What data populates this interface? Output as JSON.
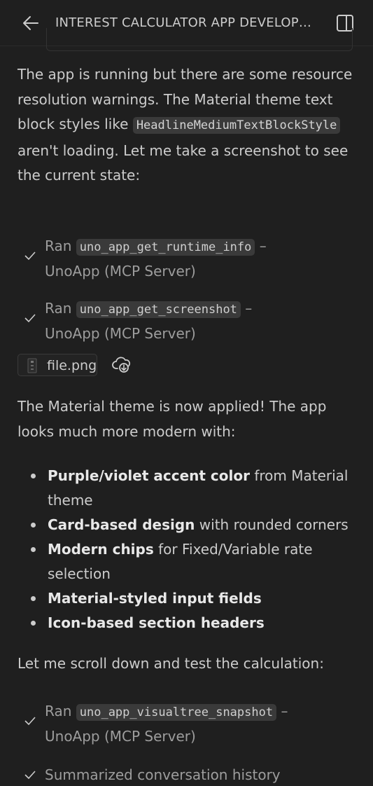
{
  "header": {
    "title": "INTEREST CALCULATOR APP DEVELOPMENT",
    "back_icon": "arrow-left-icon",
    "panel_icon": "sidebar-panel-icon"
  },
  "intro": {
    "text1": "The app is running but there are some resource resolution warnings. The Material theme text block styles like",
    "code": "HeadlineMediumTextBlockStyle",
    "text2": "aren't loading. Let me take a screenshot to see the current state:"
  },
  "tool_calls": [
    {
      "prefix": "Ran",
      "tool": "uno_app_get_runtime_info",
      "sep": "–",
      "source": "UnoApp (MCP Server)"
    },
    {
      "prefix": "Ran",
      "tool": "uno_app_get_screenshot",
      "sep": "–",
      "source": "UnoApp (MCP Server)"
    },
    {
      "prefix": "Ran",
      "tool": "uno_app_visualtree_snapshot",
      "sep": "–",
      "source": "UnoApp (MCP Server)"
    }
  ],
  "attachment": {
    "filename": "file.png"
  },
  "result": {
    "text": "The Material theme is now applied! The app looks much more modern with:"
  },
  "bullets": [
    {
      "bold": "Purple/violet accent color",
      "rest": " from Material theme"
    },
    {
      "bold": "Card-based design",
      "rest": " with rounded corners"
    },
    {
      "bold": "Modern chips",
      "rest": " for Fixed/Variable rate selection"
    },
    {
      "bold": "Material-styled input fields",
      "rest": ""
    },
    {
      "bold": "Icon-based section headers",
      "rest": ""
    }
  ],
  "scroll_text": "Let me scroll down and test the calculation:",
  "summary": "Summarized conversation history"
}
